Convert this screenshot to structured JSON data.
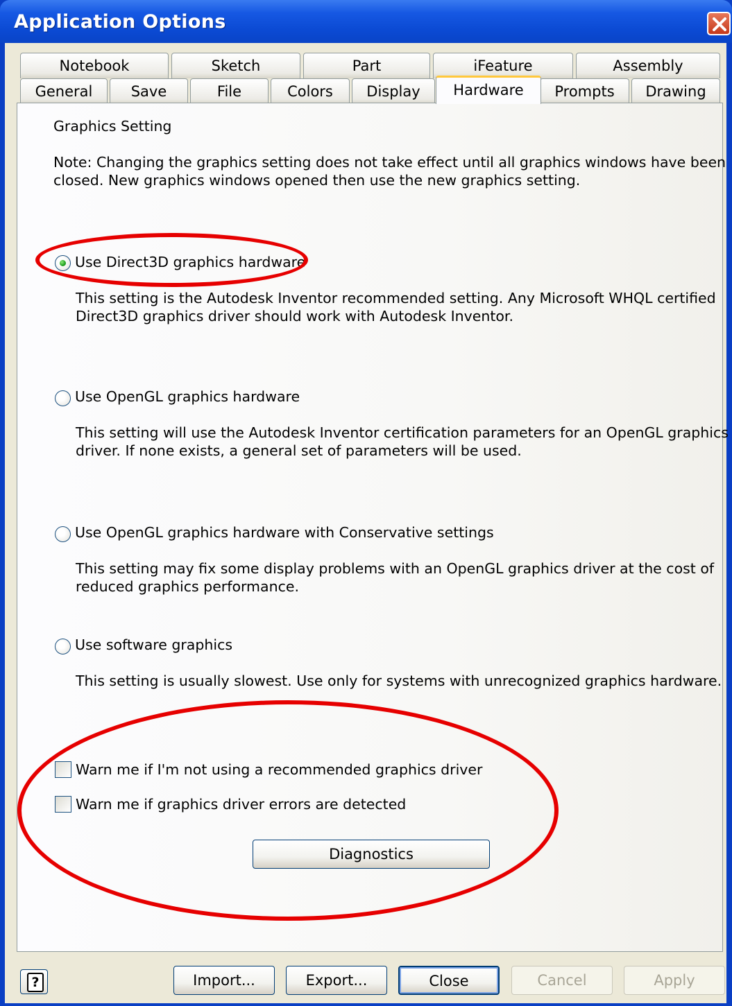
{
  "window": {
    "title": "Application Options"
  },
  "tabs_row1": [
    "Notebook",
    "Sketch",
    "Part",
    "iFeature",
    "Assembly"
  ],
  "tabs_row2": [
    "General",
    "Save",
    "File",
    "Colors",
    "Display",
    "Hardware",
    "Prompts",
    "Drawing"
  ],
  "active_tab": "Hardware",
  "panel": {
    "heading": "Graphics Setting",
    "note_line1": "Note: Changing the graphics setting does not take effect until all graphics windows have been",
    "note_line2": "closed.  New graphics windows opened then use the new graphics setting.",
    "options": [
      {
        "label": "Use Direct3D graphics hardware",
        "selected": true,
        "desc1": "This setting is the Autodesk Inventor recommended setting.  Any Microsoft WHQL certified",
        "desc2": "Direct3D graphics driver should work with Autodesk Inventor."
      },
      {
        "label": "Use OpenGL graphics hardware",
        "selected": false,
        "desc1": "This setting will use the Autodesk Inventor certification parameters for an OpenGL graphics",
        "desc2": "driver.  If none exists, a general set of parameters will be used."
      },
      {
        "label": "Use OpenGL graphics hardware with Conservative settings",
        "selected": false,
        "desc1": "This setting may fix some display problems with an OpenGL graphics driver at the cost of",
        "desc2": "reduced graphics performance."
      },
      {
        "label": "Use software graphics",
        "selected": false,
        "desc1": "This setting is usually slowest.  Use only for systems with unrecognized graphics hardware.",
        "desc2": ""
      }
    ],
    "checkboxes": [
      {
        "label": "Warn me if I'm not using a recommended graphics driver",
        "checked": false
      },
      {
        "label": "Warn me if graphics driver errors are detected",
        "checked": false
      }
    ],
    "diagnostics_label": "Diagnostics"
  },
  "footer": {
    "help_glyph": "?",
    "import_label": "Import...",
    "export_label": "Export...",
    "close_label": "Close",
    "cancel_label": "Cancel",
    "apply_label": "Apply"
  },
  "colors": {
    "annotation": "#e60000",
    "titlebar": "#0a4ad3",
    "selected_radio": "#21a121",
    "active_tab_accent": "#ffc83c"
  }
}
